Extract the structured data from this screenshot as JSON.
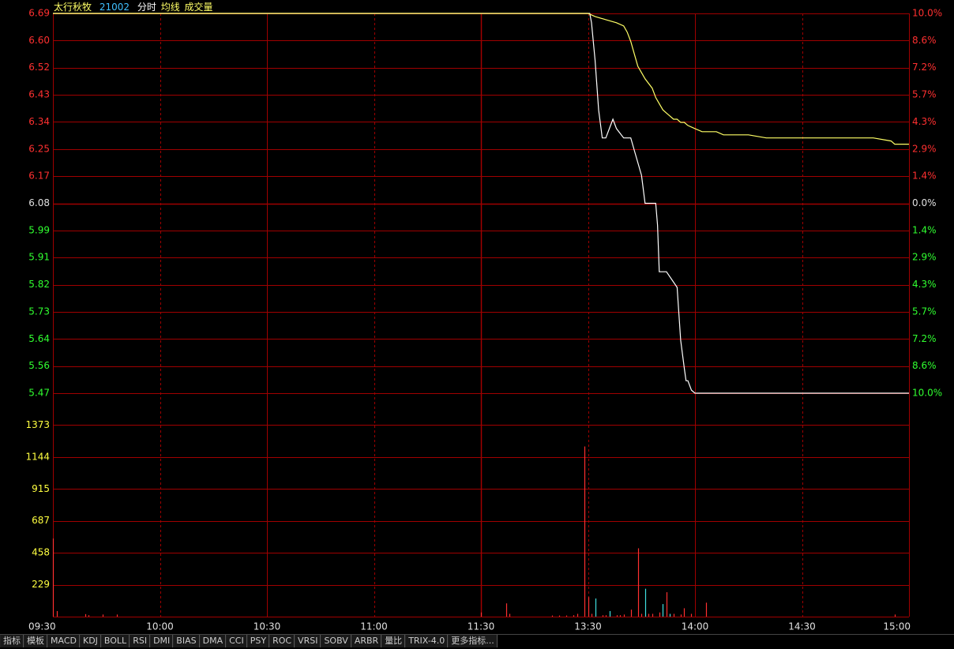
{
  "header": {
    "stock_name": "太行秋牧",
    "stock_code": "21002",
    "mode_label": "分时",
    "avg_label": "均线",
    "volume_label": "成交量"
  },
  "colors": {
    "background": "#000000",
    "grid": "#a00000",
    "price_line": "#ffffff",
    "avg_line": "#ffff66",
    "up": "#ff3030",
    "down": "#30ff30",
    "flat": "#e0e0e0",
    "volume_axis": "#ffff40",
    "time_label": "#e0e0e0"
  },
  "tabs": [
    "指标",
    "模板",
    "MACD",
    "KDJ",
    "BOLL",
    "RSI",
    "DMI",
    "BIAS",
    "DMA",
    "CCI",
    "PSY",
    "ROC",
    "VRSI",
    "SOBV",
    "ARBR",
    "量比",
    "TRIX-4.0",
    "更多指标..."
  ],
  "chart_data": {
    "type": "line",
    "price_axis": {
      "ticks": [
        "6.69",
        "6.60",
        "6.52",
        "6.43",
        "6.34",
        "6.25",
        "6.17",
        "6.08",
        "5.99",
        "5.91",
        "5.82",
        "5.73",
        "5.64",
        "5.56",
        "5.47"
      ],
      "ylim": [
        5.47,
        6.69
      ],
      "prev_close": 6.08
    },
    "pct_axis": {
      "ticks": [
        "10.0%",
        "8.6%",
        "7.2%",
        "5.7%",
        "4.3%",
        "2.9%",
        "1.4%",
        "0.0%",
        "1.4%",
        "2.9%",
        "4.3%",
        "5.7%",
        "7.2%",
        "8.6%",
        "10.0%"
      ]
    },
    "volume_axis": {
      "ticks": [
        "1373",
        "1144",
        "915",
        "687",
        "458",
        "229"
      ],
      "ylim": [
        0,
        1602
      ]
    },
    "x_axis": {
      "ticks": [
        "09:30",
        "10:00",
        "10:30",
        "11:00",
        "11:30",
        "13:30",
        "14:00",
        "14:30",
        "15:00"
      ],
      "total_minutes": 240
    },
    "series": [
      {
        "key": "price",
        "x": [
          0,
          150,
          150.5,
          151,
          152,
          153,
          154,
          155,
          156,
          157,
          158,
          160,
          162,
          163,
          165,
          166,
          169,
          169.5,
          170,
          172,
          175,
          176,
          177,
          177.5,
          178,
          179,
          180,
          240
        ],
        "y": [
          6.69,
          6.69,
          6.69,
          6.66,
          6.54,
          6.38,
          6.29,
          6.29,
          6.32,
          6.35,
          6.32,
          6.29,
          6.29,
          6.25,
          6.17,
          6.08,
          6.08,
          6.01,
          5.86,
          5.86,
          5.81,
          5.64,
          5.55,
          5.51,
          5.51,
          5.48,
          5.47,
          5.47
        ]
      },
      {
        "key": "avg",
        "x": [
          0,
          150,
          152,
          155,
          158,
          160,
          161,
          162,
          163,
          164,
          165,
          166,
          168,
          169,
          170,
          171,
          172,
          173,
          174,
          175,
          176,
          177,
          178,
          180,
          182,
          184,
          186,
          188,
          190,
          195,
          200,
          210,
          220,
          230,
          235,
          236,
          238,
          240
        ],
        "y": [
          6.69,
          6.69,
          6.68,
          6.67,
          6.66,
          6.65,
          6.63,
          6.6,
          6.56,
          6.52,
          6.5,
          6.48,
          6.45,
          6.42,
          6.4,
          6.38,
          6.37,
          6.36,
          6.35,
          6.35,
          6.34,
          6.34,
          6.33,
          6.32,
          6.31,
          6.31,
          6.31,
          6.3,
          6.3,
          6.3,
          6.29,
          6.29,
          6.29,
          6.29,
          6.28,
          6.27,
          6.27,
          6.27
        ]
      }
    ],
    "volume": [
      {
        "t": 0,
        "v": 560,
        "c": "up"
      },
      {
        "t": 1,
        "v": 40,
        "c": "up"
      },
      {
        "t": 9,
        "v": 18,
        "c": "up"
      },
      {
        "t": 10,
        "v": 10,
        "c": "up"
      },
      {
        "t": 14,
        "v": 15,
        "c": "up"
      },
      {
        "t": 18,
        "v": 15,
        "c": "up"
      },
      {
        "t": 120,
        "v": 30,
        "c": "up"
      },
      {
        "t": 127,
        "v": 95,
        "c": "up"
      },
      {
        "t": 128,
        "v": 20,
        "c": "up"
      },
      {
        "t": 140,
        "v": 8,
        "c": "up"
      },
      {
        "t": 142,
        "v": 8,
        "c": "up"
      },
      {
        "t": 144,
        "v": 8,
        "c": "up"
      },
      {
        "t": 146,
        "v": 10,
        "c": "up"
      },
      {
        "t": 147,
        "v": 20,
        "c": "up"
      },
      {
        "t": 149,
        "v": 1220,
        "c": "up"
      },
      {
        "t": 150,
        "v": 140,
        "c": "up"
      },
      {
        "t": 151,
        "v": 20,
        "c": "up"
      },
      {
        "t": 152,
        "v": 130,
        "c": "down"
      },
      {
        "t": 154,
        "v": 10,
        "c": "up"
      },
      {
        "t": 155,
        "v": 10,
        "c": "up"
      },
      {
        "t": 156,
        "v": 40,
        "c": "down"
      },
      {
        "t": 158,
        "v": 10,
        "c": "up"
      },
      {
        "t": 159,
        "v": 10,
        "c": "up"
      },
      {
        "t": 160,
        "v": 15,
        "c": "up"
      },
      {
        "t": 162,
        "v": 50,
        "c": "up"
      },
      {
        "t": 164,
        "v": 490,
        "c": "up"
      },
      {
        "t": 165,
        "v": 20,
        "c": "up"
      },
      {
        "t": 166,
        "v": 200,
        "c": "down"
      },
      {
        "t": 167,
        "v": 20,
        "c": "up"
      },
      {
        "t": 168,
        "v": 20,
        "c": "up"
      },
      {
        "t": 170,
        "v": 30,
        "c": "up"
      },
      {
        "t": 171,
        "v": 90,
        "c": "down"
      },
      {
        "t": 172,
        "v": 175,
        "c": "up"
      },
      {
        "t": 173,
        "v": 20,
        "c": "down"
      },
      {
        "t": 174,
        "v": 20,
        "c": "up"
      },
      {
        "t": 176,
        "v": 15,
        "c": "up"
      },
      {
        "t": 177,
        "v": 60,
        "c": "up"
      },
      {
        "t": 179,
        "v": 20,
        "c": "up"
      },
      {
        "t": 183,
        "v": 100,
        "c": "up"
      },
      {
        "t": 236,
        "v": 15,
        "c": "up"
      }
    ]
  }
}
